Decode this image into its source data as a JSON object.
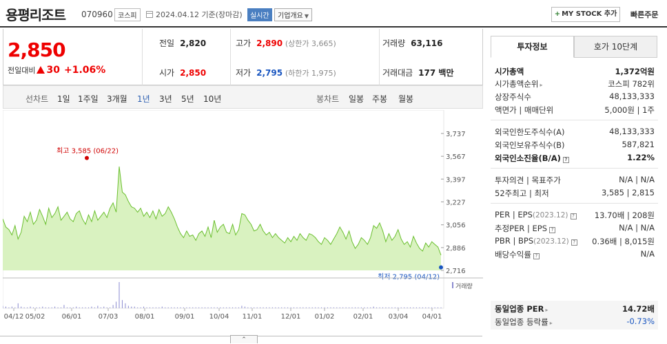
{
  "header": {
    "company_name": "용평리조트",
    "code": "070960",
    "market": "코스피",
    "date": "2024.04.12",
    "basis": "기준(장마감)",
    "realtime": "실시간",
    "company_info": "기업개요",
    "mystock_label": "MY STOCK 추가",
    "quick_order": "빠른주문"
  },
  "price": {
    "current": "2,850",
    "change_label": "전일대비",
    "change": "30",
    "change_pct": "+1.06%",
    "prev_close_label": "전일",
    "prev_close": "2,820",
    "high_label": "고가",
    "high": "2,890",
    "upper_limit": "(상한가 3,665)",
    "volume_label": "거래량",
    "volume": "63,116",
    "open_label": "시가",
    "open": "2,850",
    "low_label": "저가",
    "low": "2,795",
    "lower_limit": "(하한가 1,975)",
    "value_label": "거래대금",
    "value": "177 백만"
  },
  "period_tabs": {
    "line_label": "선차트",
    "line_items": [
      "1일",
      "1주일",
      "3개월",
      "1년",
      "3년",
      "5년",
      "10년"
    ],
    "active": "1년",
    "candle_label": "봉차트",
    "candle_items": [
      "일봉",
      "주봉",
      "월봉"
    ]
  },
  "chart_data": {
    "type": "area",
    "x_ticks": [
      "04/12",
      "05/02",
      "06/01",
      "07/03",
      "08/01",
      "09/01",
      "10/04",
      "11/01",
      "12/01",
      "01/02",
      "02/01",
      "03/04",
      "04/01"
    ],
    "y_ticks": [
      "3,737",
      "3,567",
      "3,397",
      "3,227",
      "3,056",
      "2,886",
      "2,716"
    ],
    "ylim": [
      2716,
      3737
    ],
    "max_label": "최고 3,585 (06/22)",
    "min_label": "최저 2,795 (04/12)",
    "volume_label": "거래량",
    "colors": {
      "line": "#6abf2e",
      "fill": "#d9f2c0",
      "max": "#d00000",
      "min": "#1a56c0"
    },
    "price": [
      3100,
      3040,
      3020,
      2980,
      3050,
      2950,
      3000,
      3120,
      3080,
      3150,
      3060,
      3090,
      3170,
      3120,
      3060,
      3180,
      3110,
      3140,
      3190,
      3090,
      3120,
      3150,
      3100,
      3080,
      3140,
      3160,
      3100,
      3060,
      3130,
      3080,
      3160,
      3090,
      3120,
      3150,
      3110,
      3180,
      3220,
      3150,
      3490,
      3300,
      3280,
      3230,
      3190,
      3180,
      3150,
      3180,
      3120,
      3150,
      3110,
      3160,
      3100,
      3170,
      3120,
      3140,
      3190,
      3150,
      3100,
      3040,
      2990,
      2960,
      3010,
      2970,
      2980,
      2940,
      2990,
      3010,
      2970,
      3040,
      2960,
      3090,
      3000,
      3040,
      3060,
      3000,
      2990,
      3060,
      2980,
      3020,
      3140,
      3130,
      3090,
      3060,
      3010,
      3020,
      3060,
      3010,
      2980,
      3000,
      2960,
      2990,
      2960,
      2940,
      2920,
      2960,
      2930,
      2970,
      2940,
      2990,
      2960,
      2940,
      2990,
      2980,
      2960,
      2930,
      2910,
      2960,
      2940,
      2910,
      2950,
      2990,
      3040,
      3000,
      2950,
      3010,
      2930,
      2880,
      2910,
      2960,
      2940,
      2910,
      2960,
      3050,
      3030,
      3070,
      3010,
      2930,
      2990,
      2940,
      2970,
      3020,
      2950,
      2910,
      2930,
      2890,
      2970,
      2920,
      2880,
      2860,
      2920,
      2890,
      2930,
      2910,
      2890,
      2830
    ],
    "volume": [
      0.3,
      0.2,
      0.1,
      0.2,
      0.1,
      0.6,
      0.2,
      0.1,
      0.1,
      0.2,
      0.1,
      0.1,
      0.1,
      0.2,
      0.1,
      0.1,
      0.1,
      0.2,
      0.1,
      0.1,
      0.4,
      0.1,
      0.1,
      0.1,
      0.2,
      0.1,
      0.1,
      0.1,
      0.1,
      0.2,
      0.1,
      0.3,
      0.1,
      0.2,
      0.1,
      0.1,
      0.4,
      0.8,
      3.2,
      1.0,
      0.6,
      0.3,
      0.2,
      0.2,
      0.1,
      0.1,
      0.2,
      0.1,
      0.1,
      0.1,
      0.1,
      0.1,
      0.2,
      0.1,
      0.1,
      0.1,
      0.1,
      0.1,
      0.1,
      0.1,
      0.1,
      0.1,
      0.1,
      0.1,
      0.1,
      0.1,
      0.1,
      0.1,
      0.1,
      0.1,
      0.1,
      0.1,
      0.1,
      0.1,
      0.1,
      0.1,
      0.1,
      0.1,
      0.3,
      0.2,
      0.1,
      0.1,
      0.1,
      0.1,
      0.1,
      0.1,
      0.1,
      0.1,
      0.1,
      0.1,
      0.1,
      0.1,
      0.1,
      0.1,
      0.1,
      0.1,
      0.1,
      0.1,
      0.1,
      0.1,
      0.1,
      0.1,
      0.1,
      0.1,
      0.1,
      0.1,
      0.1,
      0.1,
      0.1,
      0.1,
      0.1,
      0.1,
      0.1,
      0.1,
      0.1,
      0.1,
      0.1,
      0.1,
      0.1,
      0.1,
      0.1,
      0.2,
      0.1,
      0.1,
      0.1,
      0.1,
      0.1,
      0.1,
      0.1,
      0.1,
      0.1,
      0.1,
      0.1,
      0.1,
      0.1,
      0.1,
      0.1,
      0.1,
      0.1,
      0.1,
      0.1,
      0.1,
      0.1,
      0.1
    ]
  },
  "right_panel": {
    "tab_invest": "투자정보",
    "tab_orderbook": "호가 10단계",
    "rows": {
      "mktcap_k": "시가총액",
      "mktcap_v": "1,372억원",
      "mktcap_rank_k": "시가총액순위",
      "mktcap_rank_v": "코스피 782위",
      "shares_k": "상장주식수",
      "shares_v": "48,133,333",
      "par_k": "액면가 | 매매단위",
      "par_v": "5,000원 | 1주",
      "foreign_limit_k": "외국인한도주식수(A)",
      "foreign_limit_v": "48,133,333",
      "foreign_hold_k": "외국인보유주식수(B)",
      "foreign_hold_v": "587,821",
      "foreign_ratio_k": "외국인소진율(B/A)",
      "foreign_ratio_v": "1.22%",
      "opinion_k": "투자의견 | 목표주가",
      "opinion_v": "N/A | N/A",
      "w52_k": "52주최고 | 최저",
      "w52_v": "3,585 | 2,815",
      "per_k": "PER | EPS",
      "per_year": "(2023.12)",
      "per_v": "13.70배 | 208원",
      "est_per_k": "추정PER | EPS",
      "est_per_v": "N/A | N/A",
      "pbr_k": "PBR | BPS",
      "pbr_year": "(2023.12)",
      "pbr_v": "0.36배 | 8,015원",
      "div_k": "배당수익률",
      "div_v": "N/A",
      "sector_per_k": "동일업종 PER",
      "sector_per_v": "14.72배",
      "sector_chg_k": "동일업종 등락률",
      "sector_chg_v": "-0.73%"
    }
  },
  "collapse_symbol": "⌃"
}
